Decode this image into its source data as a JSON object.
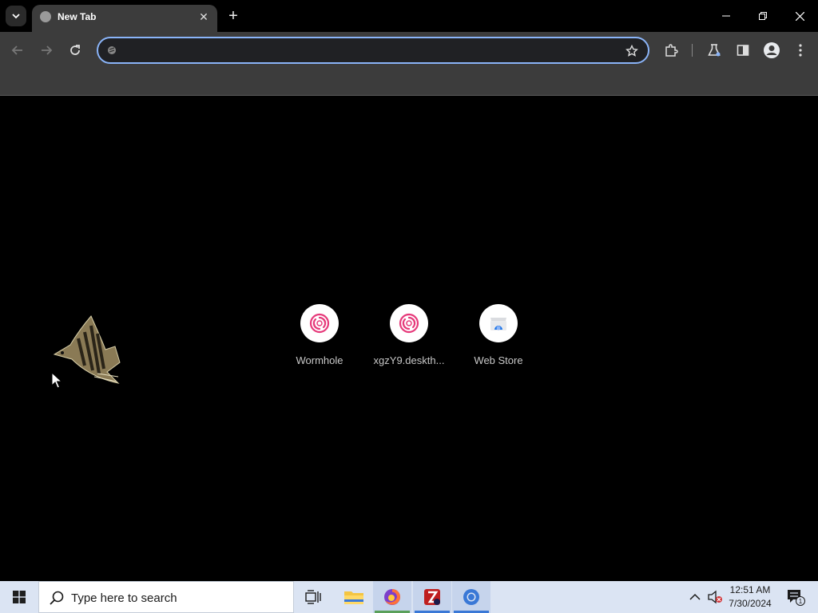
{
  "browser": {
    "tab": {
      "title": "New Tab",
      "close": "✕"
    },
    "new_tab": "+",
    "omnibox": {
      "value": "",
      "placeholder": ""
    }
  },
  "shortcuts": [
    {
      "label": "Wormhole",
      "icon": "wormhole-icon"
    },
    {
      "label": "xgzY9.deskth...",
      "icon": "wormhole-icon"
    },
    {
      "label": "Web Store",
      "icon": "web-store-icon"
    }
  ],
  "taskbar": {
    "search_placeholder": "Type here to search",
    "time": "12:51 AM",
    "date": "7/30/2024",
    "notification_count": "1"
  },
  "colors": {
    "accent": "#8ab4f8",
    "toolbar": "#3c3c3c",
    "taskbar": "#dbe4f3",
    "wormhole": "#e6397a"
  }
}
